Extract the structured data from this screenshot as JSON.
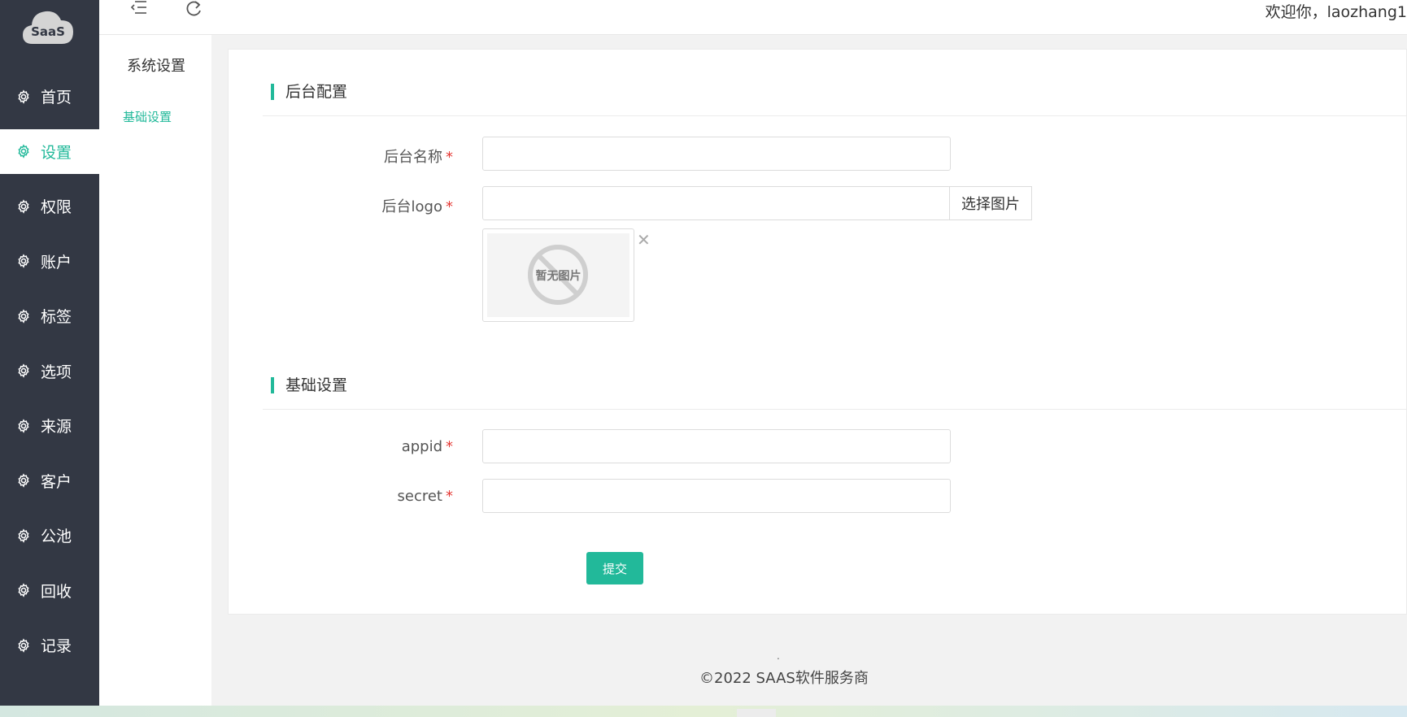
{
  "brand": {
    "logo_text": "SaaS"
  },
  "header": {
    "welcome": "欢迎你，laozhang1"
  },
  "sidebar": {
    "items": [
      {
        "label": "首页",
        "active": false
      },
      {
        "label": "设置",
        "active": true
      },
      {
        "label": "权限",
        "active": false
      },
      {
        "label": "账户",
        "active": false
      },
      {
        "label": "标签",
        "active": false
      },
      {
        "label": "选项",
        "active": false
      },
      {
        "label": "来源",
        "active": false
      },
      {
        "label": "客户",
        "active": false
      },
      {
        "label": "公池",
        "active": false
      },
      {
        "label": "回收",
        "active": false
      },
      {
        "label": "记录",
        "active": false
      }
    ]
  },
  "submenu": {
    "title": "系统设置",
    "items": [
      {
        "label": "基础设置",
        "active": true
      }
    ]
  },
  "sections": {
    "backend": {
      "title": "后台配置",
      "name_label": "后台名称",
      "name_value": "",
      "logo_label": "后台logo",
      "logo_value": "",
      "pick_button": "选择图片",
      "no_image_text": "暂无图片",
      "remove_symbol": "✕"
    },
    "basic": {
      "title": "基础设置",
      "appid_label": "appid",
      "appid_value": "",
      "secret_label": "secret",
      "secret_value": ""
    }
  },
  "required_mark": "*",
  "submit_label": "提交",
  "footer": {
    "dot": ".",
    "copyright": "©2022 SAAS软件服务商"
  },
  "colors": {
    "accent": "#22b99a",
    "sidebar_bg": "#333844",
    "required": "#e53935"
  }
}
